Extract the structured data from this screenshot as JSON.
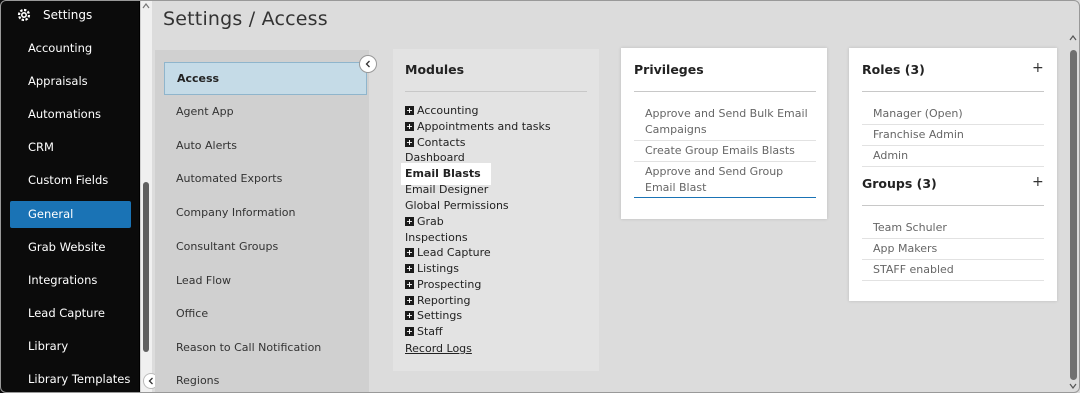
{
  "sidebar": {
    "title": "Settings",
    "items": [
      {
        "label": "Accounting"
      },
      {
        "label": "Appraisals"
      },
      {
        "label": "Automations"
      },
      {
        "label": "CRM"
      },
      {
        "label": "Custom Fields"
      },
      {
        "label": "General",
        "active": true
      },
      {
        "label": "Grab Website"
      },
      {
        "label": "Integrations"
      },
      {
        "label": "Lead Capture"
      },
      {
        "label": "Library"
      },
      {
        "label": "Library Templates"
      }
    ]
  },
  "page": {
    "title": "Settings / Access"
  },
  "subnav": {
    "items": [
      {
        "label": "Access",
        "active": true
      },
      {
        "label": "Agent App"
      },
      {
        "label": "Auto Alerts"
      },
      {
        "label": "Automated Exports"
      },
      {
        "label": "Company Information"
      },
      {
        "label": "Consultant Groups"
      },
      {
        "label": "Lead Flow"
      },
      {
        "label": "Office"
      },
      {
        "label": "Reason to Call Notification"
      },
      {
        "label": "Regions"
      }
    ]
  },
  "modules": {
    "title": "Modules",
    "items": [
      {
        "label": "Accounting",
        "expandable": true
      },
      {
        "label": "Appointments and tasks",
        "expandable": true
      },
      {
        "label": "Contacts",
        "expandable": true
      },
      {
        "label": "Dashboard",
        "expandable": false
      },
      {
        "label": "Email Blasts",
        "expandable": false,
        "selected": true
      },
      {
        "label": "Email Designer",
        "expandable": false
      },
      {
        "label": "Global Permissions",
        "expandable": false
      },
      {
        "label": "Grab",
        "expandable": true
      },
      {
        "label": "Inspections",
        "expandable": false
      },
      {
        "label": "Lead Capture",
        "expandable": true
      },
      {
        "label": "Listings",
        "expandable": true
      },
      {
        "label": "Prospecting",
        "expandable": true
      },
      {
        "label": "Reporting",
        "expandable": true
      },
      {
        "label": "Settings",
        "expandable": true
      },
      {
        "label": "Staff",
        "expandable": true
      }
    ],
    "footer_link": "Record Logs"
  },
  "privileges": {
    "title": "Privileges",
    "items": [
      {
        "line1": "Approve and Send Bulk Email",
        "line2": "Campaigns"
      },
      {
        "line1": "Create Group Emails Blasts",
        "line2": ""
      },
      {
        "line1": "Approve and Send Group",
        "line2": "Email Blast",
        "selected": true
      }
    ]
  },
  "roles": {
    "title": "Roles (3)",
    "items": [
      "Manager (Open)",
      "Franchise Admin",
      "Admin"
    ]
  },
  "groups": {
    "title": "Groups (3)",
    "items": [
      "Team Schuler",
      "App Makers",
      "STAFF enabled"
    ]
  },
  "colors": {
    "sidebar_bg": "#0b0b0b",
    "active_blue": "#1a73b5",
    "subnav_active": "#c5dbe7"
  }
}
